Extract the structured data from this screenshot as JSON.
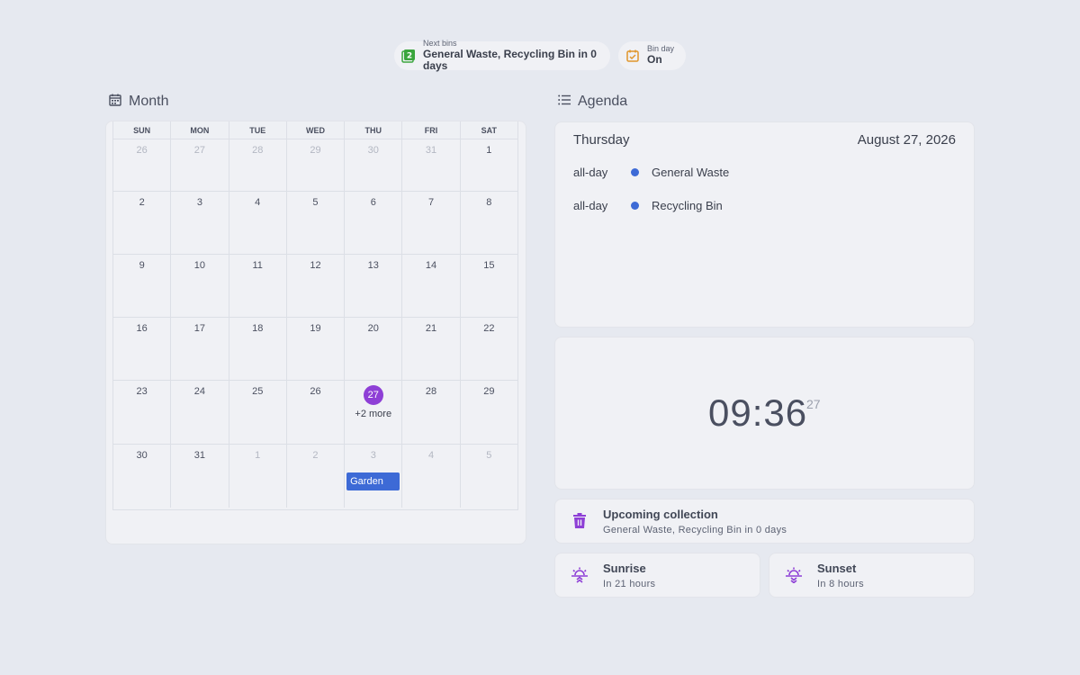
{
  "chips": {
    "next_bins": {
      "label": "Next bins",
      "value": "General Waste, Recycling Bin in 0 days",
      "color": "#3aa53d"
    },
    "bin_day": {
      "label": "Bin day",
      "value": "On",
      "color": "#e0962b"
    }
  },
  "month": {
    "title": "Month",
    "weekdays": [
      "SUN",
      "MON",
      "TUE",
      "WED",
      "THU",
      "FRI",
      "SAT"
    ],
    "weeks": [
      [
        {
          "d": "26",
          "m": true
        },
        {
          "d": "27",
          "m": true
        },
        {
          "d": "28",
          "m": true
        },
        {
          "d": "29",
          "m": true
        },
        {
          "d": "30",
          "m": true
        },
        {
          "d": "31",
          "m": true
        },
        {
          "d": "1"
        }
      ],
      [
        {
          "d": "2"
        },
        {
          "d": "3"
        },
        {
          "d": "4"
        },
        {
          "d": "5"
        },
        {
          "d": "6"
        },
        {
          "d": "7"
        },
        {
          "d": "8"
        }
      ],
      [
        {
          "d": "9"
        },
        {
          "d": "10"
        },
        {
          "d": "11"
        },
        {
          "d": "12"
        },
        {
          "d": "13"
        },
        {
          "d": "14"
        },
        {
          "d": "15"
        }
      ],
      [
        {
          "d": "16"
        },
        {
          "d": "17"
        },
        {
          "d": "18"
        },
        {
          "d": "19"
        },
        {
          "d": "20"
        },
        {
          "d": "21"
        },
        {
          "d": "22"
        }
      ],
      [
        {
          "d": "23"
        },
        {
          "d": "24"
        },
        {
          "d": "25"
        },
        {
          "d": "26"
        },
        {
          "d": "27",
          "today": true,
          "more": "+2 more"
        },
        {
          "d": "28"
        },
        {
          "d": "29"
        }
      ],
      [
        {
          "d": "30"
        },
        {
          "d": "31"
        },
        {
          "d": "1",
          "m": true
        },
        {
          "d": "2",
          "m": true
        },
        {
          "d": "3",
          "m": true,
          "event": "Garden"
        },
        {
          "d": "4",
          "m": true
        },
        {
          "d": "5",
          "m": true
        }
      ]
    ],
    "today_color": "#8e3fd6",
    "event_color": "#3d6ad6"
  },
  "agenda": {
    "title": "Agenda",
    "day_name": "Thursday",
    "date": "August 27, 2026",
    "items": [
      {
        "when": "all-day",
        "name": "General Waste",
        "color": "#3d6ad6"
      },
      {
        "when": "all-day",
        "name": "Recycling Bin",
        "color": "#3d6ad6"
      }
    ]
  },
  "clock": {
    "time": "09:36",
    "seconds": "27"
  },
  "upcoming": {
    "title": "Upcoming collection",
    "subtitle": "General Waste, Recycling Bin in 0 days",
    "color": "#8e3fd6"
  },
  "sunrise": {
    "title": "Sunrise",
    "subtitle": "In 21 hours",
    "color": "#8e3fd6"
  },
  "sunset": {
    "title": "Sunset",
    "subtitle": "In 8 hours",
    "color": "#8e3fd6"
  }
}
